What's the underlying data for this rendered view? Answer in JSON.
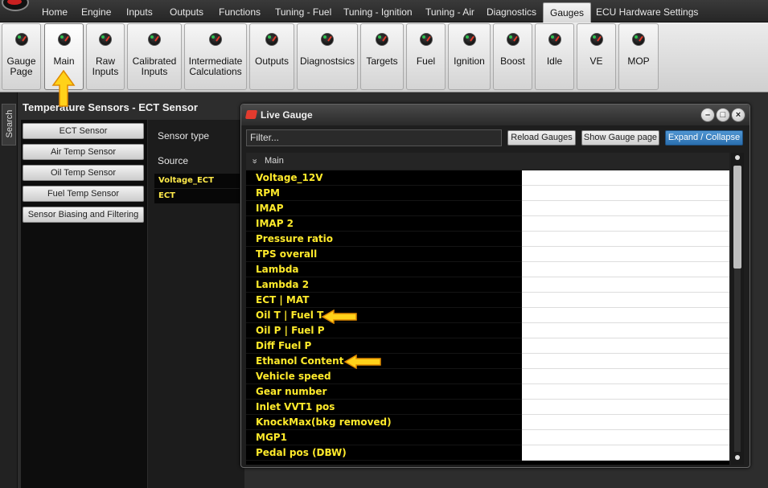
{
  "menubar": {
    "items": [
      {
        "label": "Home",
        "active": false
      },
      {
        "label": "Engine",
        "active": false
      },
      {
        "label": "Inputs",
        "active": false
      },
      {
        "label": "Outputs",
        "active": false
      },
      {
        "label": "Functions",
        "active": false
      },
      {
        "label": "Tuning - Fuel",
        "active": false
      },
      {
        "label": "Tuning - Ignition",
        "active": false
      },
      {
        "label": "Tuning - Air",
        "active": false
      },
      {
        "label": "Diagnostics",
        "active": false
      },
      {
        "label": "Gauges",
        "active": true
      },
      {
        "label": "ECU Hardware Settings",
        "active": false
      }
    ]
  },
  "ribbon": {
    "buttons": [
      {
        "line1": "Gauge",
        "line2": "Page",
        "icon": "gauge-icon"
      },
      {
        "line1": "Main",
        "line2": "",
        "icon": "gauge-icon",
        "active": true
      },
      {
        "line1": "Raw",
        "line2": "Inputs",
        "icon": "gauge-icon"
      },
      {
        "line1": "Calibrated",
        "line2": "Inputs",
        "icon": "gauge-icon"
      },
      {
        "line1": "Intermediate",
        "line2": "Calculations",
        "icon": "gauge-icon"
      },
      {
        "line1": "Outputs",
        "line2": "",
        "icon": "gauge-icon"
      },
      {
        "line1": "Diagnostsics",
        "line2": "",
        "icon": "gauge-icon"
      },
      {
        "line1": "Targets",
        "line2": "",
        "icon": "gauge-icon"
      },
      {
        "line1": "Fuel",
        "line2": "",
        "icon": "gauge-icon"
      },
      {
        "line1": "Ignition",
        "line2": "",
        "icon": "gauge-icon"
      },
      {
        "line1": "Boost",
        "line2": "",
        "icon": "gauge-icon"
      },
      {
        "line1": "Idle",
        "line2": "",
        "icon": "gauge-icon"
      },
      {
        "line1": "VE",
        "line2": "",
        "icon": "gauge-icon"
      },
      {
        "line1": "MOP",
        "line2": "",
        "icon": "gauge-icon"
      }
    ]
  },
  "search_tab": {
    "label": "Search"
  },
  "page": {
    "title": "Temperature Sensors - ECT Sensor",
    "side_buttons": [
      "ECT Sensor",
      "Air Temp Sensor",
      "Oil Temp Sensor",
      "Fuel Temp Sensor",
      "Sensor Biasing and Filtering"
    ],
    "properties": [
      {
        "label": "Sensor type",
        "value": ""
      },
      {
        "label": "Source",
        "value": "Voltage_ECT"
      }
    ],
    "source_option_2": "ECT"
  },
  "live_gauge": {
    "title": "Live Gauge",
    "filter_placeholder": "Filter...",
    "buttons": {
      "reload": "Reload Gauges",
      "show_page": "Show Gauge page",
      "expand": "Expand / Collapse"
    },
    "window_controls": {
      "minimize": "–",
      "maximize": "□",
      "close": "×"
    },
    "group": {
      "chevron": "»",
      "name": "Main"
    },
    "rows": [
      {
        "name": "Voltage_12V",
        "value": ""
      },
      {
        "name": "RPM",
        "value": ""
      },
      {
        "name": "IMAP",
        "value": ""
      },
      {
        "name": "IMAP 2",
        "value": ""
      },
      {
        "name": "Pressure ratio",
        "value": ""
      },
      {
        "name": "TPS overall",
        "value": ""
      },
      {
        "name": "Lambda",
        "value": ""
      },
      {
        "name": "Lambda 2",
        "value": ""
      },
      {
        "name": "ECT | MAT",
        "value": ""
      },
      {
        "name": "Oil T | Fuel T",
        "value": ""
      },
      {
        "name": "Oil P | Fuel P",
        "value": ""
      },
      {
        "name": "Diff Fuel P",
        "value": ""
      },
      {
        "name": "Ethanol Content",
        "value": ""
      },
      {
        "name": "Vehicle speed",
        "value": ""
      },
      {
        "name": "Gear number",
        "value": ""
      },
      {
        "name": "Inlet VVT1 pos",
        "value": ""
      },
      {
        "name": "KnockMax(bkg removed)",
        "value": ""
      },
      {
        "name": "MGP1",
        "value": ""
      },
      {
        "name": "Pedal pos (DBW)",
        "value": ""
      }
    ]
  },
  "colors": {
    "gauge_text": "#ffea2b",
    "arrow_fill": "#ffd21a",
    "accent_blue": "#2b6fae"
  }
}
